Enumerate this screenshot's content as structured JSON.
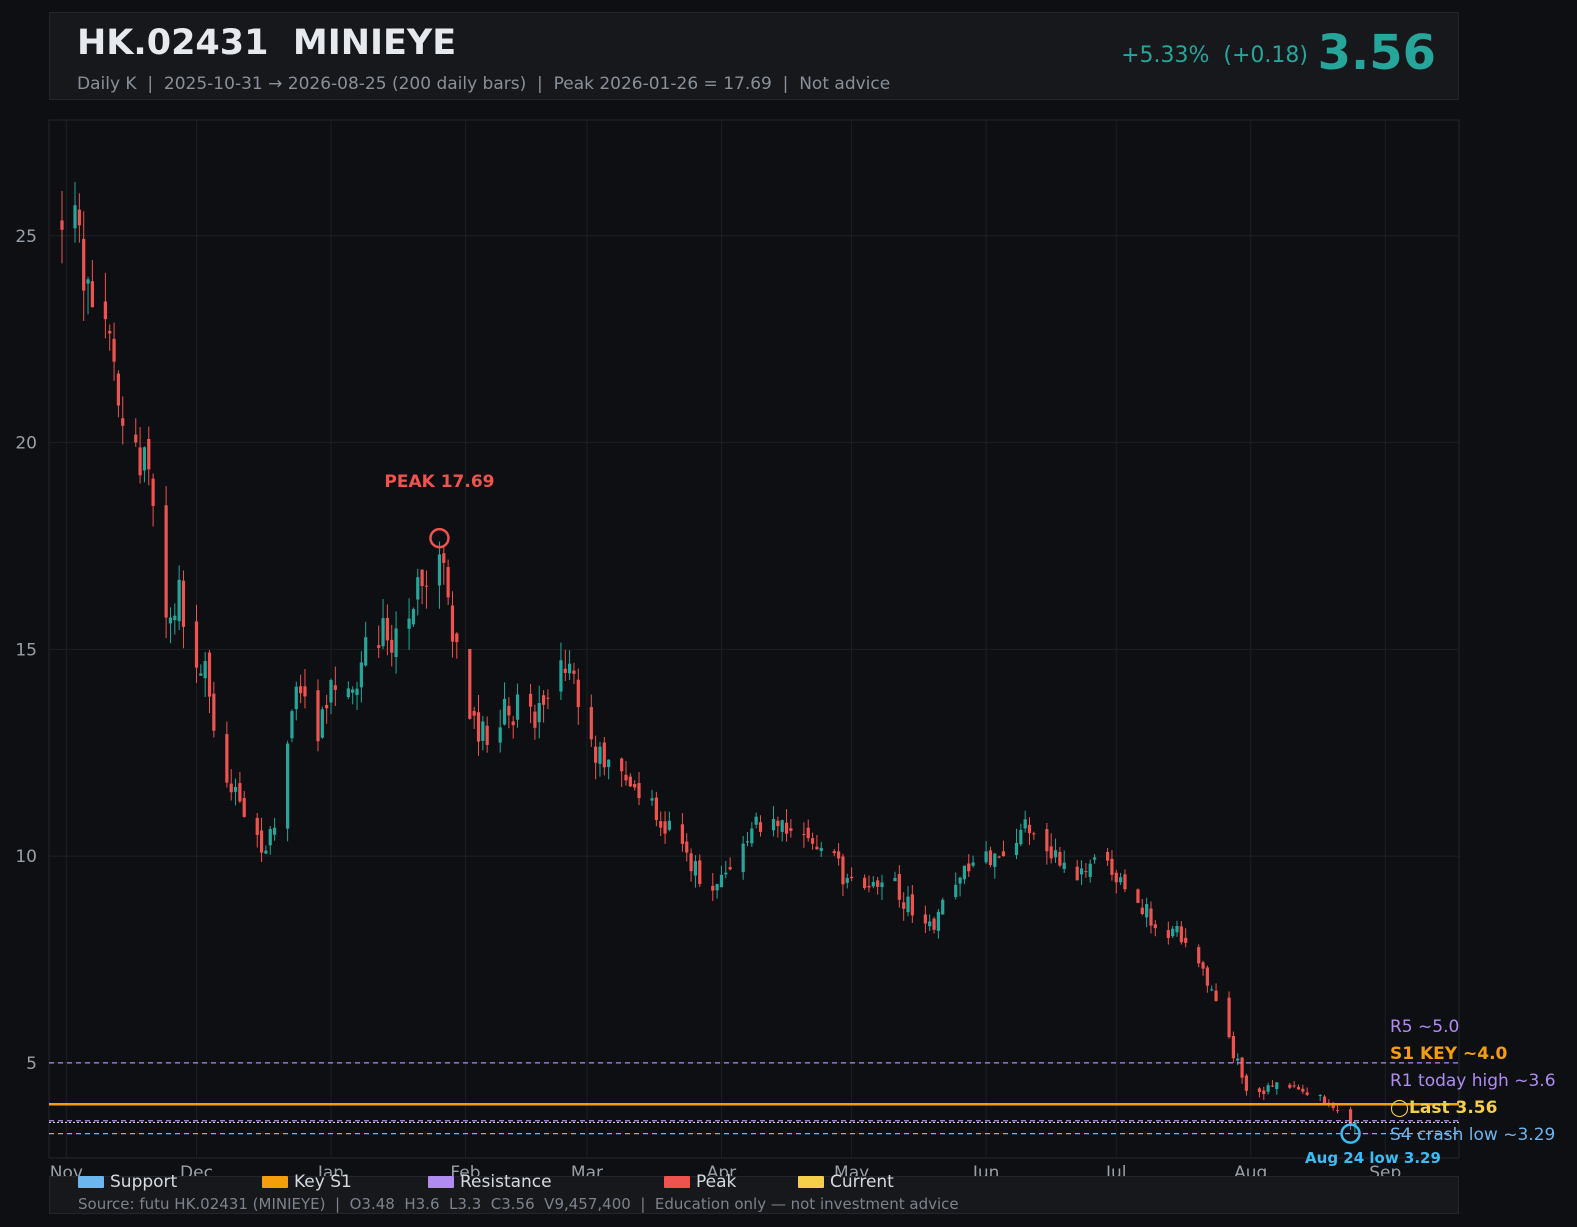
{
  "header": {
    "ticker": "HK.02431",
    "name": "MINIEYE",
    "subtitle": "Daily K  |  2025-10-31 → 2026-08-25 (200 daily bars)  |  Peak 2026-01-26 = 17.69  |  Not advice",
    "change_pct": "+5.33%",
    "change_abs": "(+0.18)",
    "price": "3.56"
  },
  "legend": [
    {
      "label": "Support",
      "color": "#6cb6f0"
    },
    {
      "label": "Key S1",
      "color": "#f59e0b"
    },
    {
      "label": "Resistance",
      "color": "#b08cf0"
    },
    {
      "label": "Peak",
      "color": "#ef5350"
    },
    {
      "label": "Current",
      "color": "#f5cf4a"
    }
  ],
  "footer": {
    "source": "Source: futu HK.02431 (MINIEYE)  |  O3.48  H3.6  L3.3  C3.56  V9,457,400  |  Education only — not investment advice"
  },
  "colors": {
    "up": "#26a69a",
    "down": "#ef5350",
    "support": "#6cb6f0",
    "key_support": "#f59e0b",
    "resistance": "#b08cf0",
    "current": "#f5cf4a",
    "low_marker": "#38bdf8",
    "grid": "#1c1f24"
  },
  "chart_data": {
    "type": "candlestick",
    "x_range": [
      "2025-10-31",
      "2026-09-15"
    ],
    "ylim": [
      2.7,
      27.8
    ],
    "y_ticks": [
      5,
      10,
      15,
      20,
      25
    ],
    "x_ticks": [
      {
        "date": "2025-11-01",
        "label": "Nov"
      },
      {
        "date": "2025-12-01",
        "label": "Dec"
      },
      {
        "date": "2026-01-01",
        "label": "Jan"
      },
      {
        "date": "2026-02-01",
        "label": "Feb"
      },
      {
        "date": "2026-03-01",
        "label": "Mar"
      },
      {
        "date": "2026-04-01",
        "label": "Apr"
      },
      {
        "date": "2026-05-01",
        "label": "May"
      },
      {
        "date": "2026-06-01",
        "label": "Jun"
      },
      {
        "date": "2026-07-01",
        "label": "Jul"
      },
      {
        "date": "2026-08-01",
        "label": "Aug"
      },
      {
        "date": "2026-09-01",
        "label": "Sep"
      }
    ],
    "grid": true,
    "close_path": [
      [
        "2025-10-31",
        25.6
      ],
      [
        "2025-11-03",
        25.9
      ],
      [
        "2025-11-05",
        24.2
      ],
      [
        "2025-11-07",
        23.6
      ],
      [
        "2025-11-11",
        22.8
      ],
      [
        "2025-11-13",
        21.2
      ],
      [
        "2025-11-15",
        20.2
      ],
      [
        "2025-11-19",
        19.6
      ],
      [
        "2025-11-21",
        18.5
      ],
      [
        "2025-11-24",
        15.8
      ],
      [
        "2025-11-27",
        16.2
      ],
      [
        "2025-11-30",
        14.8
      ],
      [
        "2025-12-03",
        14.6
      ],
      [
        "2025-12-05",
        13.2
      ],
      [
        "2025-12-08",
        12.0
      ],
      [
        "2025-12-11",
        11.0
      ],
      [
        "2025-12-14",
        10.2
      ],
      [
        "2025-12-17",
        10.3
      ],
      [
        "2025-12-20",
        11.2
      ],
      [
        "2025-12-23",
        13.8
      ],
      [
        "2025-12-26",
        14.0
      ],
      [
        "2025-12-29",
        12.8
      ],
      [
        "2026-01-01",
        14.2
      ],
      [
        "2026-01-04",
        13.6
      ],
      [
        "2026-01-07",
        14.4
      ],
      [
        "2026-01-10",
        15.1
      ],
      [
        "2026-01-13",
        15.4
      ],
      [
        "2026-01-16",
        15.2
      ],
      [
        "2026-01-19",
        16.2
      ],
      [
        "2026-01-22",
        16.8
      ],
      [
        "2026-01-26",
        17.3
      ],
      [
        "2026-01-28",
        16.0
      ],
      [
        "2026-01-31",
        14.2
      ],
      [
        "2026-02-03",
        13.2
      ],
      [
        "2026-02-06",
        12.9
      ],
      [
        "2026-02-09",
        13.4
      ],
      [
        "2026-02-13",
        13.6
      ],
      [
        "2026-02-17",
        13.3
      ],
      [
        "2026-02-21",
        13.9
      ],
      [
        "2026-02-24",
        14.8
      ],
      [
        "2026-02-27",
        13.6
      ],
      [
        "2026-03-03",
        12.6
      ],
      [
        "2026-03-07",
        12.2
      ],
      [
        "2026-03-11",
        11.6
      ],
      [
        "2026-03-15",
        11.2
      ],
      [
        "2026-03-19",
        10.8
      ],
      [
        "2026-03-23",
        10.2
      ],
      [
        "2026-03-27",
        9.6
      ],
      [
        "2026-03-31",
        9.4
      ],
      [
        "2026-04-04",
        9.9
      ],
      [
        "2026-04-08",
        10.6
      ],
      [
        "2026-04-13",
        10.9
      ],
      [
        "2026-04-17",
        10.6
      ],
      [
        "2026-04-21",
        10.4
      ],
      [
        "2026-04-25",
        10.0
      ],
      [
        "2026-04-29",
        9.6
      ],
      [
        "2026-05-03",
        9.3
      ],
      [
        "2026-05-08",
        9.5
      ],
      [
        "2026-05-12",
        9.1
      ],
      [
        "2026-05-16",
        8.5
      ],
      [
        "2026-05-20",
        8.2
      ],
      [
        "2026-05-24",
        9.5
      ],
      [
        "2026-05-28",
        9.8
      ],
      [
        "2026-06-02",
        9.9
      ],
      [
        "2026-06-06",
        10.3
      ],
      [
        "2026-06-10",
        10.6
      ],
      [
        "2026-06-14",
        10.2
      ],
      [
        "2026-06-18",
        9.8
      ],
      [
        "2026-06-22",
        9.5
      ],
      [
        "2026-06-26",
        9.9
      ],
      [
        "2026-06-30",
        9.6
      ],
      [
        "2026-07-04",
        9.1
      ],
      [
        "2026-07-08",
        8.6
      ],
      [
        "2026-07-12",
        8.3
      ],
      [
        "2026-07-16",
        8.0
      ],
      [
        "2026-07-20",
        7.6
      ],
      [
        "2026-07-23",
        6.8
      ],
      [
        "2026-07-26",
        5.8
      ],
      [
        "2026-07-29",
        5.0
      ],
      [
        "2026-07-31",
        4.4
      ],
      [
        "2026-08-03",
        4.3
      ],
      [
        "2026-08-06",
        4.5
      ],
      [
        "2026-08-10",
        4.4
      ],
      [
        "2026-08-14",
        4.3
      ],
      [
        "2026-08-18",
        4.1
      ],
      [
        "2026-08-21",
        3.8
      ],
      [
        "2026-08-24",
        3.45
      ],
      [
        "2026-08-25",
        3.56
      ]
    ],
    "reference_lines": [
      {
        "label": "R5 ~5.0",
        "value": 5.0,
        "style": "dashed",
        "role": "resistance"
      },
      {
        "label": "S1 KEY ~4.0",
        "value": 4.0,
        "style": "solid",
        "role": "key_support"
      },
      {
        "label": "R1 today high ~3.6",
        "value": 3.6,
        "style": "dashed",
        "role": "resistance"
      },
      {
        "label": "◯Last 3.56",
        "value": 3.56,
        "style": "dotted",
        "role": "current"
      },
      {
        "label": "S4 crash low ~3.29",
        "value": 3.29,
        "style": "dashed",
        "role": "support"
      }
    ],
    "annotations": [
      {
        "text": "PEAK 17.69",
        "date": "2026-01-26",
        "value": 17.69,
        "role": "peak"
      },
      {
        "text": "Aug 24 low 3.29",
        "date": "2026-08-24",
        "value": 3.29,
        "role": "low"
      }
    ]
  }
}
